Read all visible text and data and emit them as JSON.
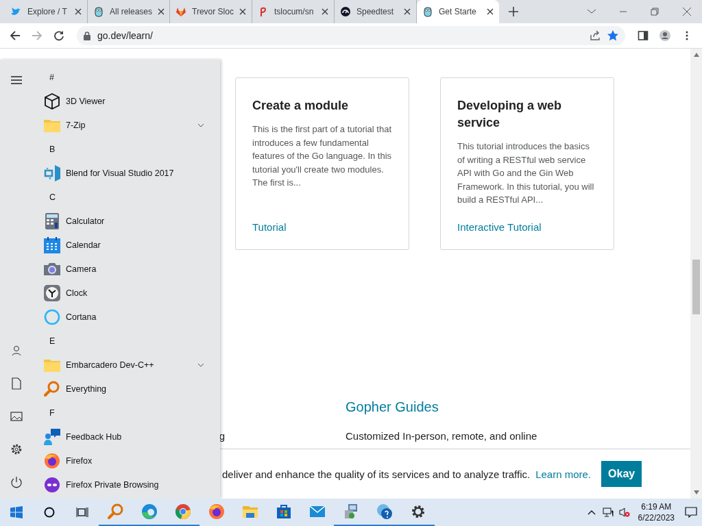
{
  "browser": {
    "tabs": [
      {
        "title": "Explore / T",
        "selected": false
      },
      {
        "title": "All releases",
        "selected": false
      },
      {
        "title": "Trevor Sloc",
        "selected": false
      },
      {
        "title": "tslocum/sn",
        "selected": false
      },
      {
        "title": "Speedtest",
        "selected": false
      },
      {
        "title": "Get Starte",
        "selected": true
      }
    ],
    "address": "go.dev/learn/",
    "bookmarked": true
  },
  "page": {
    "cards": [
      {
        "title": "Create a module",
        "description": "This is the first part of a tutorial that introduces a few fundamental features of the Go language. In this tutorial you'll create two modules. The first is...",
        "link": "Tutorial"
      },
      {
        "title": "Developing a web service",
        "description": "This tutorial introduces the basics of writing a RESTful web service API with Go and the Gin Web Framework. In this tutorial, you will build a RESTful API...",
        "link": "Interactive Tutorial"
      }
    ],
    "guides": {
      "left_fragment": "g",
      "title": "Gopher Guides",
      "description": "Customized In-person, remote, and online"
    },
    "cookie_banner": {
      "text": "deliver and enhance the quality of its services and to analyze traffic.",
      "link": "Learn more.",
      "button": "Okay"
    }
  },
  "start_menu": {
    "items": [
      {
        "kind": "header",
        "label": "#"
      },
      {
        "kind": "app",
        "label": "3D Viewer"
      },
      {
        "kind": "folder",
        "label": "7-Zip"
      },
      {
        "kind": "header",
        "label": "B"
      },
      {
        "kind": "app",
        "label": "Blend for Visual Studio 2017"
      },
      {
        "kind": "header",
        "label": "C"
      },
      {
        "kind": "app",
        "label": "Calculator"
      },
      {
        "kind": "app",
        "label": "Calendar"
      },
      {
        "kind": "app",
        "label": "Camera"
      },
      {
        "kind": "app",
        "label": "Clock"
      },
      {
        "kind": "app",
        "label": "Cortana"
      },
      {
        "kind": "header",
        "label": "E"
      },
      {
        "kind": "folder",
        "label": "Embarcadero Dev-C++"
      },
      {
        "kind": "app",
        "label": "Everything"
      },
      {
        "kind": "header",
        "label": "F"
      },
      {
        "kind": "app",
        "label": "Feedback Hub"
      },
      {
        "kind": "app",
        "label": "Firefox"
      },
      {
        "kind": "app",
        "label": "Firefox Private Browsing"
      }
    ]
  },
  "taskbar": {
    "apps": [
      {
        "running": true
      },
      {
        "running": true
      },
      {
        "running": true
      },
      {
        "running": false
      },
      {
        "running": false
      },
      {
        "running": false
      },
      {
        "running": false
      },
      {
        "running": true
      },
      {
        "running": true
      },
      {
        "running": true
      }
    ],
    "time": "6:19 AM",
    "date": "6/22/2023"
  }
}
